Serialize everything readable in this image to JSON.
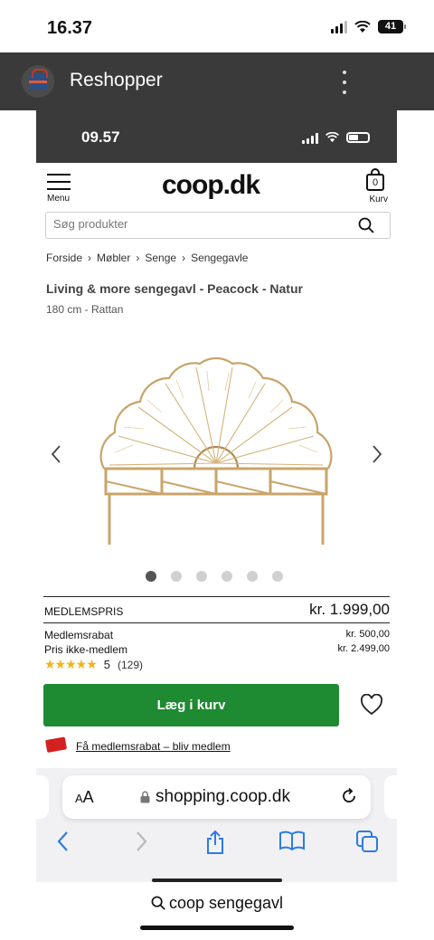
{
  "outer_status": {
    "time": "16.37",
    "battery": "41"
  },
  "app_bar": {
    "title": "Reshopper"
  },
  "inner_status": {
    "time": "09.57"
  },
  "site": {
    "menu_label": "Menu",
    "brand": "coop.dk",
    "cart_count": "0",
    "cart_label": "Kurv",
    "search_placeholder": "Søg produkter"
  },
  "breadcrumb": [
    "Forside",
    "Møbler",
    "Senge",
    "Sengegavle"
  ],
  "product": {
    "title": "Living & more sengegavl - Peacock - Natur",
    "subtitle": "180 cm - Rattan",
    "gallery_count": 6,
    "gallery_active": 0
  },
  "pricing": {
    "member_label": "MEDLEMSPRIS",
    "member_price": "kr. 1.999,00",
    "discount_label": "Medlemsrabat",
    "discount_value": "kr. 500,00",
    "nonmember_label": "Pris ikke-medlem",
    "nonmember_value": "kr. 2.499,00"
  },
  "rating": {
    "stars": "★★★★★",
    "score": "5",
    "count": "(129)",
    "value": 5
  },
  "actions": {
    "add_to_cart": "Læg i kurv",
    "membership_link": "Få medlemsrabat – bliv medlem"
  },
  "browser": {
    "aa_small": "A",
    "aa_large": "A",
    "url": "shopping.coop.dk"
  },
  "bottom_query": "coop sengegavl",
  "colors": {
    "green": "#1e8a32",
    "star": "#f3b21c",
    "app_bar": "#3a3a3a"
  },
  "icons": [
    "search-icon",
    "cart-icon",
    "heart-icon",
    "back-icon",
    "forward-icon",
    "share-icon",
    "bookmarks-icon",
    "tabs-icon",
    "reload-icon",
    "lock-icon",
    "wifi-icon",
    "more-icon"
  ]
}
